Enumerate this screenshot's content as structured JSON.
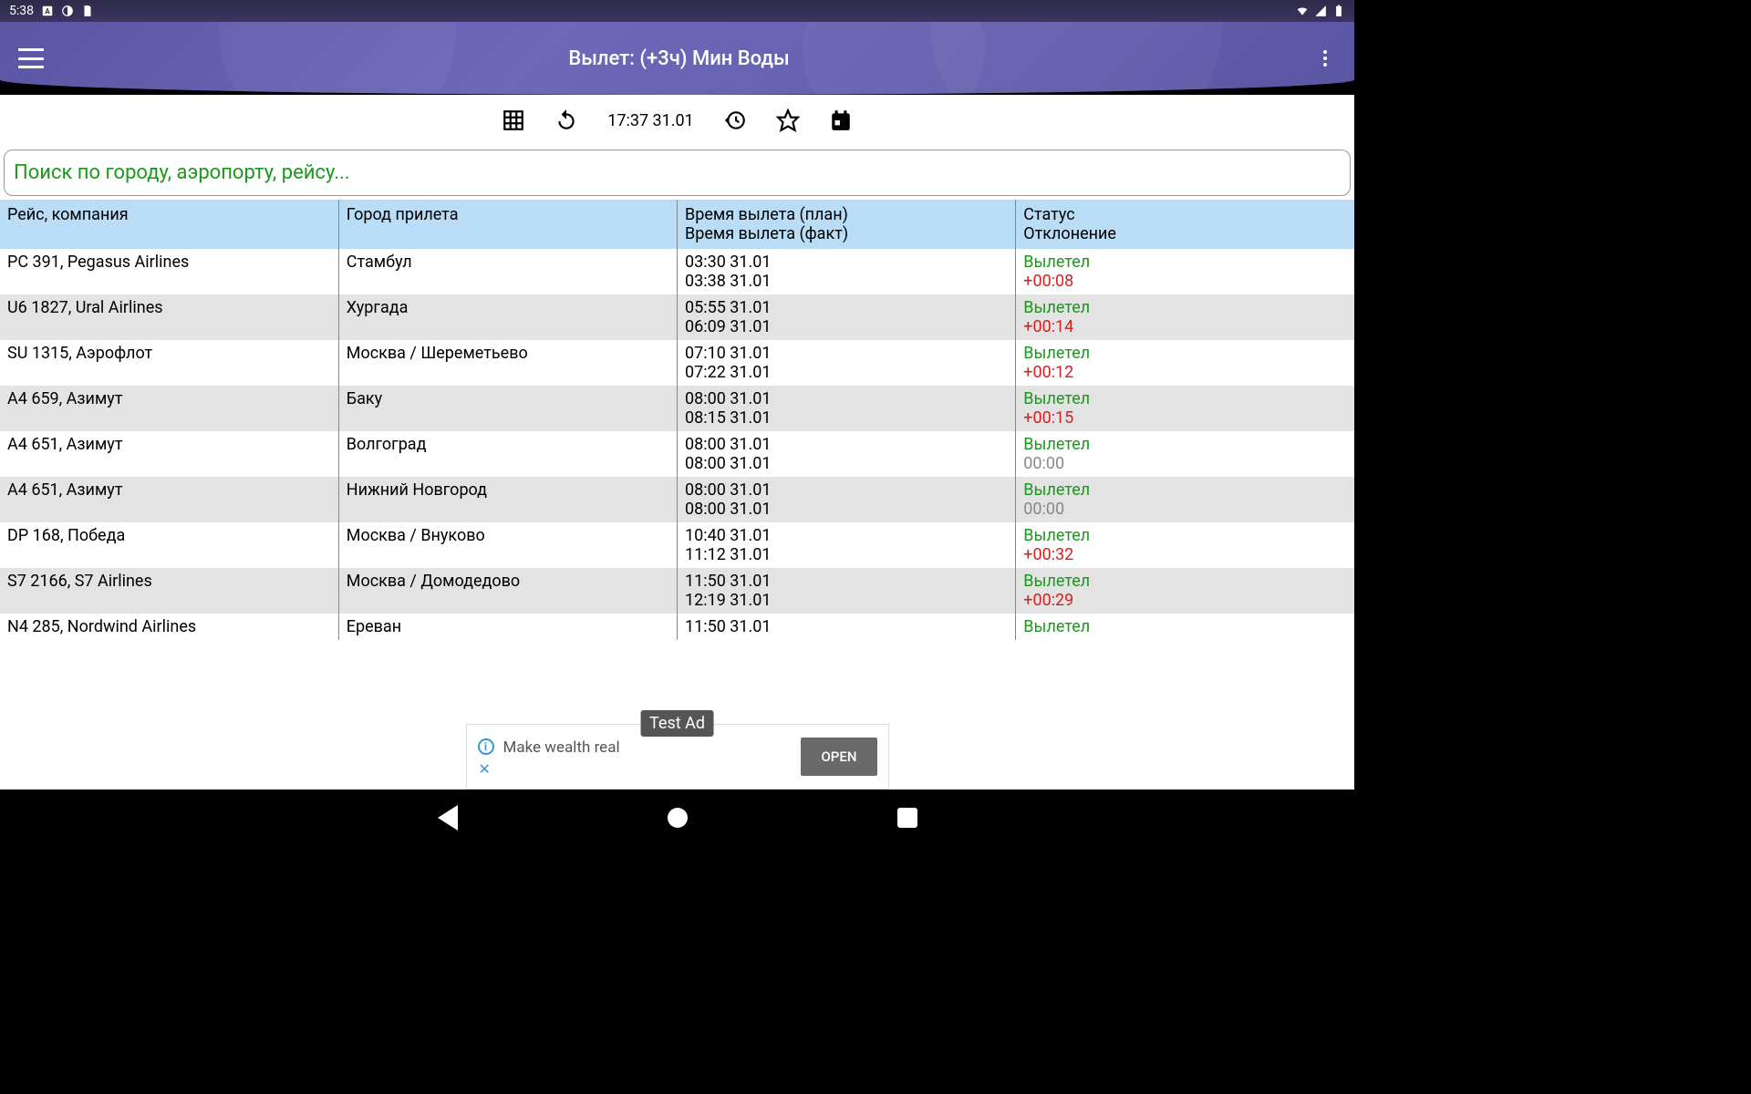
{
  "status_bar": {
    "time": "5:38"
  },
  "header": {
    "title": "Вылет: (+3ч) Мин Воды"
  },
  "toolbar": {
    "datetime": "17:37 31.01"
  },
  "search": {
    "placeholder": "Поиск по городу, аэропорту, рейсу..."
  },
  "table": {
    "headers": {
      "flight": "Рейс, компания",
      "city": "Город прилета",
      "time1": "Время вылета (план)",
      "time2": "Время вылета (факт)",
      "status": "Статус",
      "deviation": "Отклонение"
    },
    "rows": [
      {
        "flight": "PC 391, Pegasus Airlines",
        "city": "Стамбул",
        "time_plan": "03:30 31.01",
        "time_fact": "03:38 31.01",
        "status": "Вылетел",
        "deviation": "+00:08",
        "dev_class": "dev-red"
      },
      {
        "flight": "U6 1827, Ural Airlines",
        "city": "Хургада",
        "time_plan": "05:55 31.01",
        "time_fact": "06:09 31.01",
        "status": "Вылетел",
        "deviation": "+00:14",
        "dev_class": "dev-red"
      },
      {
        "flight": "SU 1315, Аэрофлот",
        "city": "Москва / Шереметьево",
        "time_plan": "07:10 31.01",
        "time_fact": "07:22 31.01",
        "status": "Вылетел",
        "deviation": "+00:12",
        "dev_class": "dev-red"
      },
      {
        "flight": "A4 659, Азимут",
        "city": "Баку",
        "time_plan": "08:00 31.01",
        "time_fact": "08:15 31.01",
        "status": "Вылетел",
        "deviation": "+00:15",
        "dev_class": "dev-red"
      },
      {
        "flight": "A4 651, Азимут",
        "city": "Волгоград",
        "time_plan": "08:00 31.01",
        "time_fact": "08:00 31.01",
        "status": "Вылетел",
        "deviation": "00:00",
        "dev_class": "dev-gray"
      },
      {
        "flight": "A4 651, Азимут",
        "city": "Нижний Новгород",
        "time_plan": "08:00 31.01",
        "time_fact": "08:00 31.01",
        "status": "Вылетел",
        "deviation": "00:00",
        "dev_class": "dev-gray"
      },
      {
        "flight": "DP 168, Победа",
        "city": "Москва / Внуково",
        "time_plan": "10:40 31.01",
        "time_fact": "11:12 31.01",
        "status": "Вылетел",
        "deviation": "+00:32",
        "dev_class": "dev-red"
      },
      {
        "flight": "S7 2166, S7 Airlines",
        "city": "Москва / Домодедово",
        "time_plan": "11:50 31.01",
        "time_fact": "12:19 31.01",
        "status": "Вылетел",
        "deviation": "+00:29",
        "dev_class": "dev-red"
      },
      {
        "flight": "N4 285, Nordwind Airlines",
        "city": "Ереван",
        "time_plan": "11:50 31.01",
        "time_fact": "",
        "status": "Вылетел",
        "deviation": "",
        "dev_class": ""
      }
    ]
  },
  "ad": {
    "badge": "Test Ad",
    "text": "Make wealth real",
    "button": "OPEN"
  }
}
